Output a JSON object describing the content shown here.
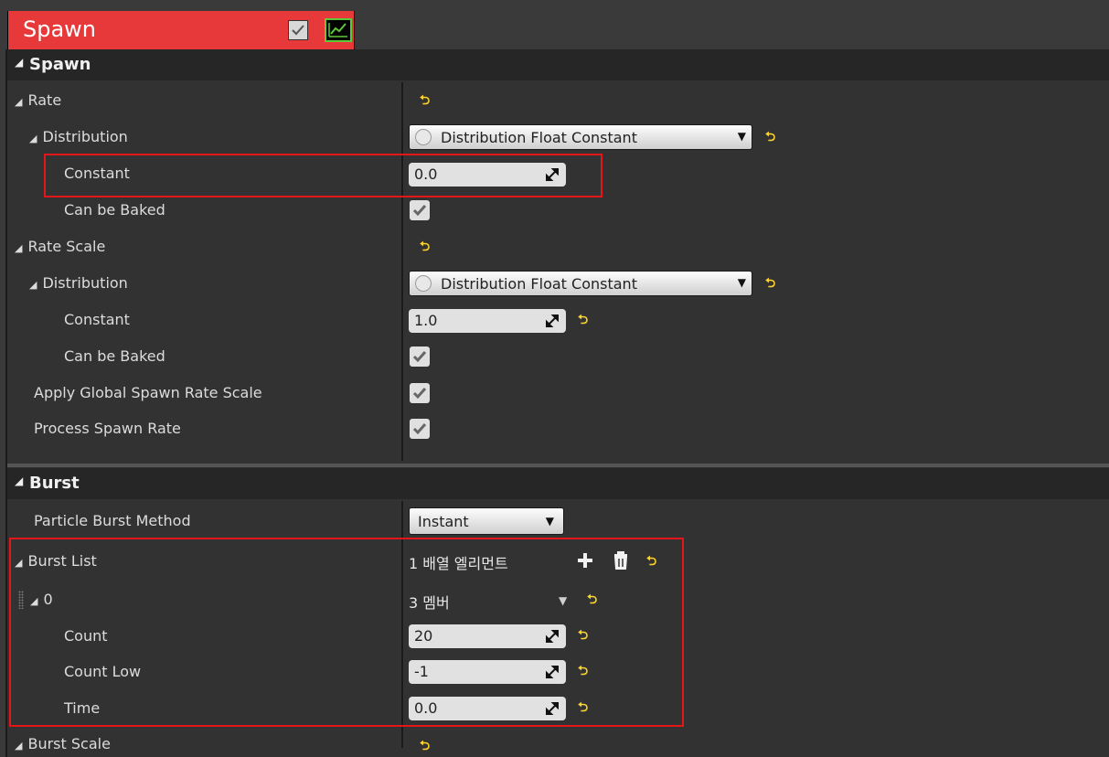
{
  "tab": {
    "title": "Spawn",
    "enabled_icon": "checkbox-icon",
    "graph_icon": "curve-graph-icon"
  },
  "spawn_section": {
    "title": "Spawn",
    "rate": {
      "label": "Rate"
    },
    "rate_distribution": {
      "label": "Distribution",
      "value": "Distribution Float Constant"
    },
    "rate_constant": {
      "label": "Constant",
      "value": "0.0"
    },
    "rate_can_be_baked": {
      "label": "Can be Baked",
      "checked": true
    },
    "rate_scale": {
      "label": "Rate Scale"
    },
    "rate_scale_distribution": {
      "label": "Distribution",
      "value": "Distribution Float Constant"
    },
    "rate_scale_constant": {
      "label": "Constant",
      "value": "1.0"
    },
    "rate_scale_can_be_baked": {
      "label": "Can be Baked",
      "checked": true
    },
    "apply_global": {
      "label": "Apply Global Spawn Rate Scale",
      "checked": true
    },
    "process_spawn_rate": {
      "label": "Process Spawn Rate",
      "checked": true
    }
  },
  "burst_section": {
    "title": "Burst",
    "method": {
      "label": "Particle Burst Method",
      "value": "Instant"
    },
    "burst_list": {
      "label": "Burst List",
      "value": "1 배열 엘리먼트"
    },
    "element0": {
      "label": "0",
      "value": "3 멤버"
    },
    "count": {
      "label": "Count",
      "value": "20"
    },
    "count_low": {
      "label": "Count Low",
      "value": "-1"
    },
    "time": {
      "label": "Time",
      "value": "0.0"
    },
    "burst_scale": {
      "label": "Burst Scale"
    }
  },
  "glyphs": {
    "reset": "⮌",
    "triangle": "◢",
    "dropdown": "▼"
  },
  "colors": {
    "tab": "#e8393a",
    "highlight": "#e3161a",
    "reset_icon": "#ffd52c",
    "graph": "#5ec93a"
  }
}
